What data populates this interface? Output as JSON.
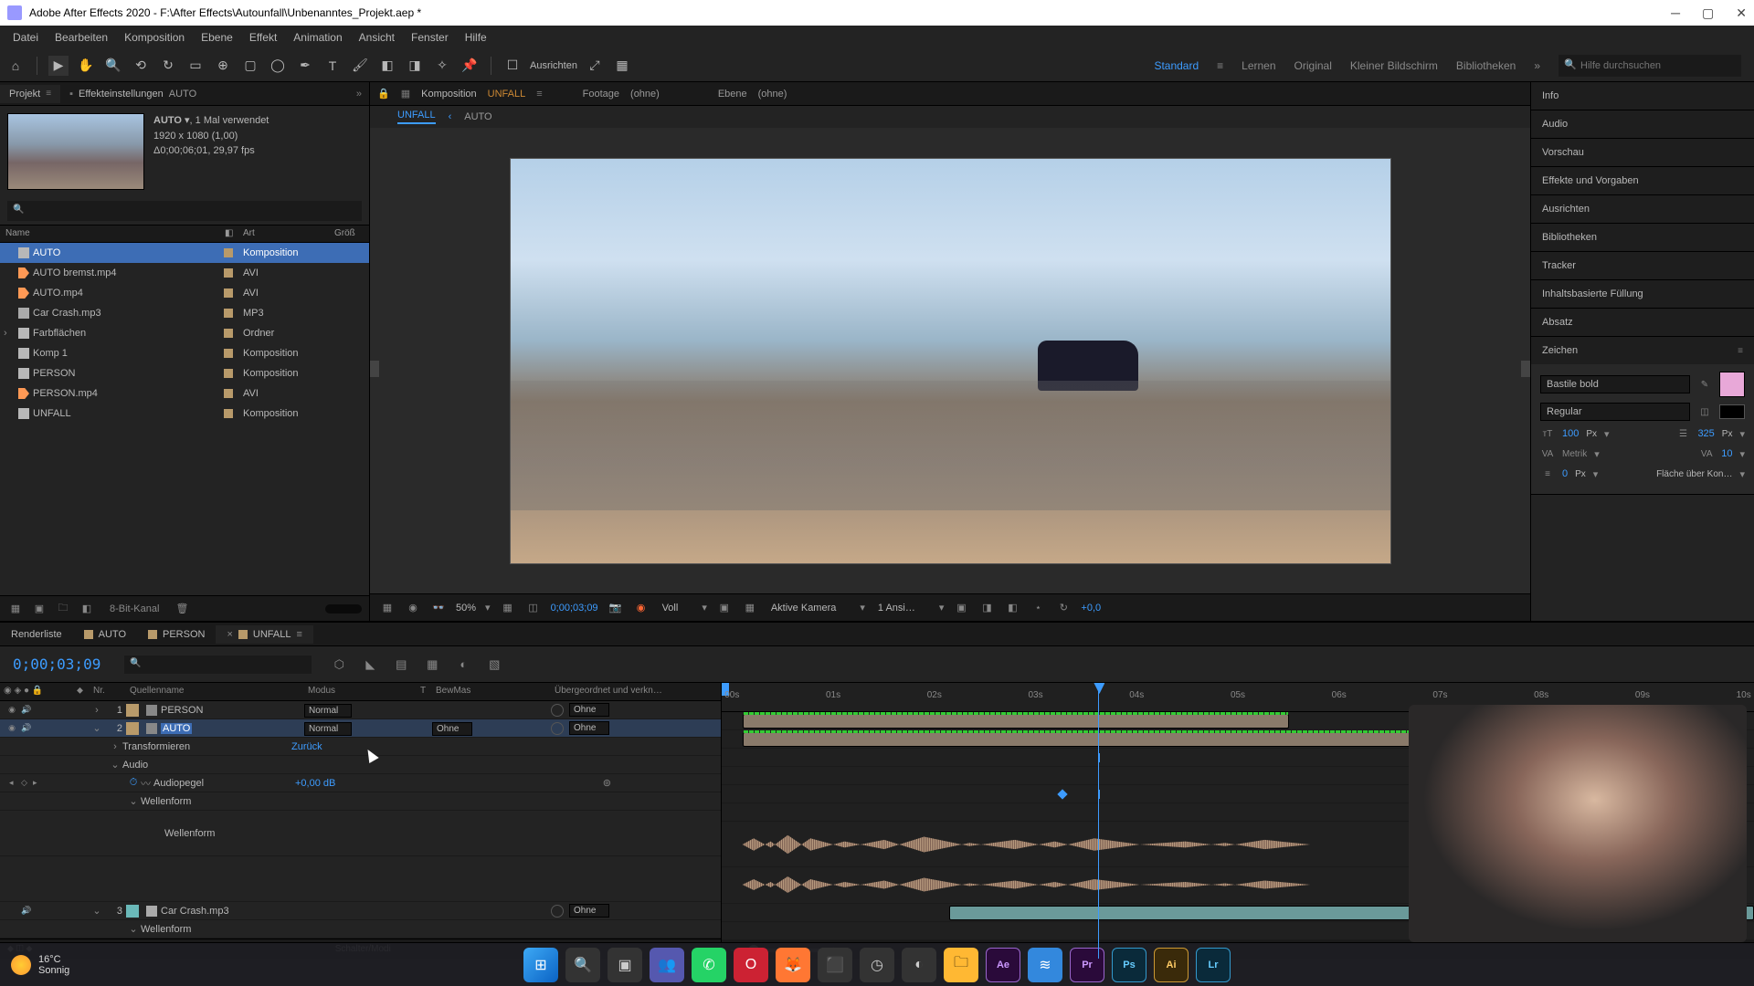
{
  "title": "Adobe After Effects 2020 - F:\\After Effects\\Autounfall\\Unbenanntes_Projekt.aep *",
  "menu": [
    "Datei",
    "Bearbeiten",
    "Komposition",
    "Ebene",
    "Effekt",
    "Animation",
    "Ansicht",
    "Fenster",
    "Hilfe"
  ],
  "toolbar": {
    "align": "Ausrichten"
  },
  "workspace": {
    "tabs": [
      "Standard",
      "Lernen",
      "Original",
      "Kleiner Bildschirm",
      "Bibliotheken"
    ],
    "active": "Standard",
    "help_placeholder": "Hilfe durchsuchen"
  },
  "project_panel": {
    "tab_project": "Projekt",
    "tab_effect": "Effekteinstellungen",
    "tab_effect_target": "AUTO",
    "selected_name": "AUTO",
    "selected_usage": ", 1 Mal verwendet",
    "selected_dims": "1920 x 1080 (1,00)",
    "selected_dur": "Δ0;00;06;01, 29,97 fps",
    "cols": {
      "name": "Name",
      "type": "Art",
      "size": "Größ"
    },
    "items": [
      {
        "name": "AUTO",
        "type": "Komposition",
        "icon": "comp",
        "label": "#b89a6a",
        "selected": true
      },
      {
        "name": "AUTO bremst.mp4",
        "type": "AVI",
        "icon": "video",
        "label": "#b89a6a"
      },
      {
        "name": "AUTO.mp4",
        "type": "AVI",
        "icon": "video",
        "label": "#b89a6a"
      },
      {
        "name": "Car Crash.mp3",
        "type": "MP3",
        "icon": "audio",
        "label": "#b89a6a"
      },
      {
        "name": "Farbflächen",
        "type": "Ordner",
        "icon": "folder",
        "label": "#b89a6a",
        "expandable": true
      },
      {
        "name": "Komp 1",
        "type": "Komposition",
        "icon": "comp",
        "label": "#b89a6a"
      },
      {
        "name": "PERSON",
        "type": "Komposition",
        "icon": "comp",
        "label": "#b89a6a"
      },
      {
        "name": "PERSON.mp4",
        "type": "AVI",
        "icon": "video",
        "label": "#b89a6a"
      },
      {
        "name": "UNFALL",
        "type": "Komposition",
        "icon": "comp",
        "label": "#b89a6a"
      }
    ],
    "bit_depth": "8-Bit-Kanal"
  },
  "viewer": {
    "comp_label": "Komposition",
    "comp_name": "UNFALL",
    "footage_label": "Footage",
    "footage_val": "(ohne)",
    "layer_label": "Ebene",
    "layer_val": "(ohne)",
    "subtabs": [
      "UNFALL",
      "AUTO"
    ],
    "active_subtab": "UNFALL",
    "subtab_chev": "‹",
    "zoom": "50%",
    "timecode": "0;00;03;09",
    "resolution": "Voll",
    "camera": "Aktive Kamera",
    "views": "1 Ansi…",
    "exposure": "+0,0"
  },
  "right_panels": {
    "items": [
      "Info",
      "Audio",
      "Vorschau",
      "Effekte und Vorgaben",
      "Ausrichten",
      "Bibliotheken",
      "Tracker",
      "Inhaltsbasierte Füllung",
      "Absatz"
    ],
    "character_title": "Zeichen",
    "font": "Bastile bold",
    "style": "Regular",
    "size": "100",
    "size_unit": "Px",
    "leading": "325",
    "leading_unit": "Px",
    "kerning": "Metrik",
    "tracking": "10",
    "stroke": "0",
    "stroke_unit": "Px",
    "fill_label": "Fläche über Kon…"
  },
  "timeline": {
    "tabs": [
      {
        "name": "Renderliste"
      },
      {
        "name": "AUTO",
        "sw": "#b89a6a"
      },
      {
        "name": "PERSON",
        "sw": "#b89a6a"
      },
      {
        "name": "UNFALL",
        "sw": "#b89a6a",
        "active": true,
        "closeable": true
      }
    ],
    "timecode": "0;00;03;09",
    "cols": {
      "nr": "Nr.",
      "src": "Quellenname",
      "mode": "Modus",
      "t": "T",
      "trk": "BewMas",
      "parent": "Übergeordnet und verkn…"
    },
    "layers": [
      {
        "nr": 1,
        "name": "PERSON",
        "sw": "#b89a6a",
        "mode": "Normal",
        "parent": "Ohne"
      },
      {
        "nr": 2,
        "name": "AUTO",
        "sw": "#b89a6a",
        "mode": "Normal",
        "trk": "Ohne",
        "parent": "Ohne",
        "selected": true
      }
    ],
    "props": {
      "transform": "Transformieren",
      "transform_reset": "Zurück",
      "audio": "Audio",
      "audiolevel": "Audiopegel",
      "audiolevel_val": "+0,00 dB",
      "waveform": "Wellenform",
      "waveform_inner": "Wellenform"
    },
    "layer3": {
      "nr": 3,
      "name": "Car Crash.mp3",
      "sw": "#b89a6a",
      "parent": "Ohne"
    },
    "footer": "Schalter/Modi",
    "ruler": [
      "00s",
      "01s",
      "02s",
      "03s",
      "04s",
      "05s",
      "06s",
      "07s",
      "08s",
      "09s",
      "10s"
    ]
  },
  "weather": {
    "temp": "16°C",
    "cond": "Sonnig"
  }
}
